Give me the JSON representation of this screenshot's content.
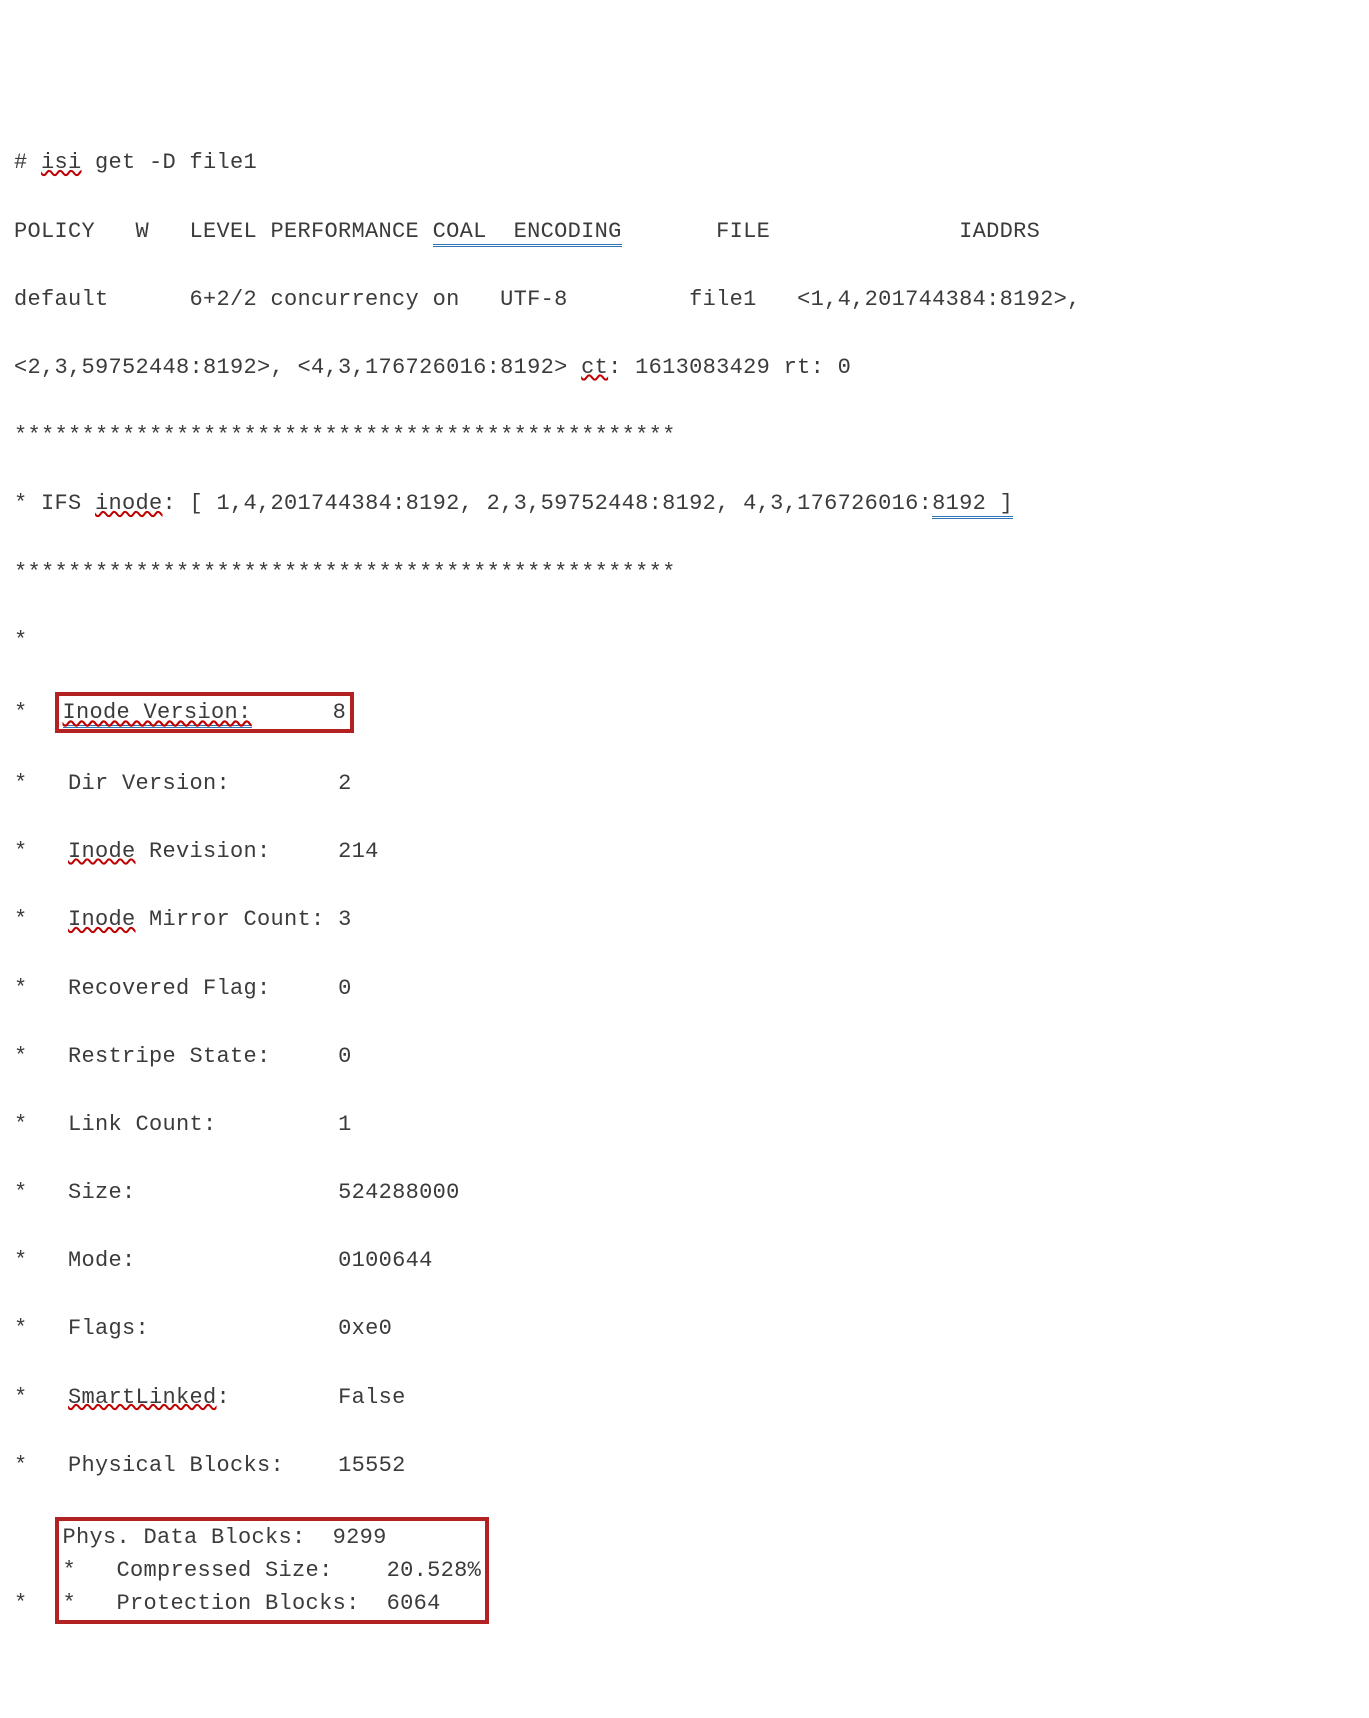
{
  "cmd": {
    "hash": "# ",
    "isi": "isi",
    "rest": " get -D file1"
  },
  "header": {
    "policy": "POLICY   W   LEVEL PERFORMANCE ",
    "coal": "COAL  ENCODING",
    "file": "       FILE              IADDRS"
  },
  "row1": {
    "a": "default      6+2/2 concurrency on   UTF-8         file1   <1,4,201744384:8192>,"
  },
  "row2": {
    "a": "<2,3,59752448:8192>, <4,3,176726016:8192> ",
    "ct": "ct",
    "b": ": 1613083429 rt: 0"
  },
  "stars1": "*************************************************",
  "ifs": {
    "a": "* IFS ",
    "inode": "inode",
    "b": ": [ 1,4,201744384:8192, 2,3,59752448:8192, 4,3,176726016:",
    "c": "8192 ]"
  },
  "stars2": "*************************************************",
  "lonestar": "*",
  "fields": {
    "inode_ver_label": "Inode Version:",
    "inode_ver_value": "8",
    "dir_ver": {
      "label": "Dir Version:",
      "value": "2"
    },
    "inode_rev": {
      "label_a": "Inode",
      "label_b": " Revision:",
      "value": "214"
    },
    "mirror": {
      "label_a": "Inode",
      "label_b": " Mirror Count:",
      "value": "3"
    },
    "recovered": {
      "label": "Recovered Flag:",
      "value": "0"
    },
    "restripe": {
      "label": "Restripe State:",
      "value": "0"
    },
    "link": {
      "label": "Link Count:",
      "value": "1"
    },
    "size": {
      "label": "Size:",
      "value": "524288000"
    },
    "mode": {
      "label": "Mode:",
      "value": "0100644"
    },
    "flags": {
      "label": "Flags:",
      "value": "0xe0"
    },
    "smartlinked": {
      "label": "SmartLinked",
      "colon": ":",
      "value": "False"
    },
    "physblocks": {
      "label": "Physical Blocks:",
      "value": "15552"
    },
    "physdata": {
      "label": "Phys. Data Blocks:",
      "value": "9299"
    },
    "compsize": {
      "label": "Compressed Size:",
      "value": "20.528%"
    },
    "protblocks": {
      "label": "Protection Blocks:",
      "value": "6064"
    }
  }
}
